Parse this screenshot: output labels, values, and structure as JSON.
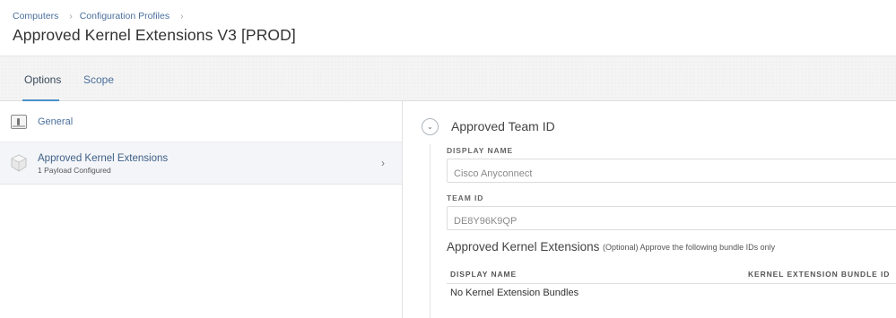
{
  "breadcrumb": {
    "items": [
      "Computers",
      "Configuration Profiles"
    ],
    "separator": "›"
  },
  "page": {
    "title": "Approved Kernel Extensions V3 [PROD]"
  },
  "tabs": [
    {
      "label": "Options",
      "active": true
    },
    {
      "label": "Scope",
      "active": false
    }
  ],
  "sidebar": {
    "items": [
      {
        "label": "General",
        "icon": "general-settings-icon"
      },
      {
        "label": "Approved Kernel Extensions",
        "sublabel": "1 Payload Configured",
        "icon": "kernel-extension-icon",
        "selected": true
      }
    ]
  },
  "section": {
    "title": "Approved Team ID",
    "fields": [
      {
        "label": "DISPLAY NAME",
        "value": "Cisco Anyconnect"
      },
      {
        "label": "TEAM ID",
        "value": "DE8Y96K9QP"
      }
    ],
    "subsection": {
      "title": "Approved Kernel Extensions",
      "hint": "(Optional) Approve the following bundle IDs only",
      "columns": [
        "DISPLAY NAME",
        "KERNEL EXTENSION BUNDLE ID"
      ],
      "empty_text": "No Kernel Extension Bundles"
    }
  },
  "colors": {
    "link": "#4a6f9c",
    "accent": "#4a90c8",
    "selected_row": "#f3f5f8"
  }
}
